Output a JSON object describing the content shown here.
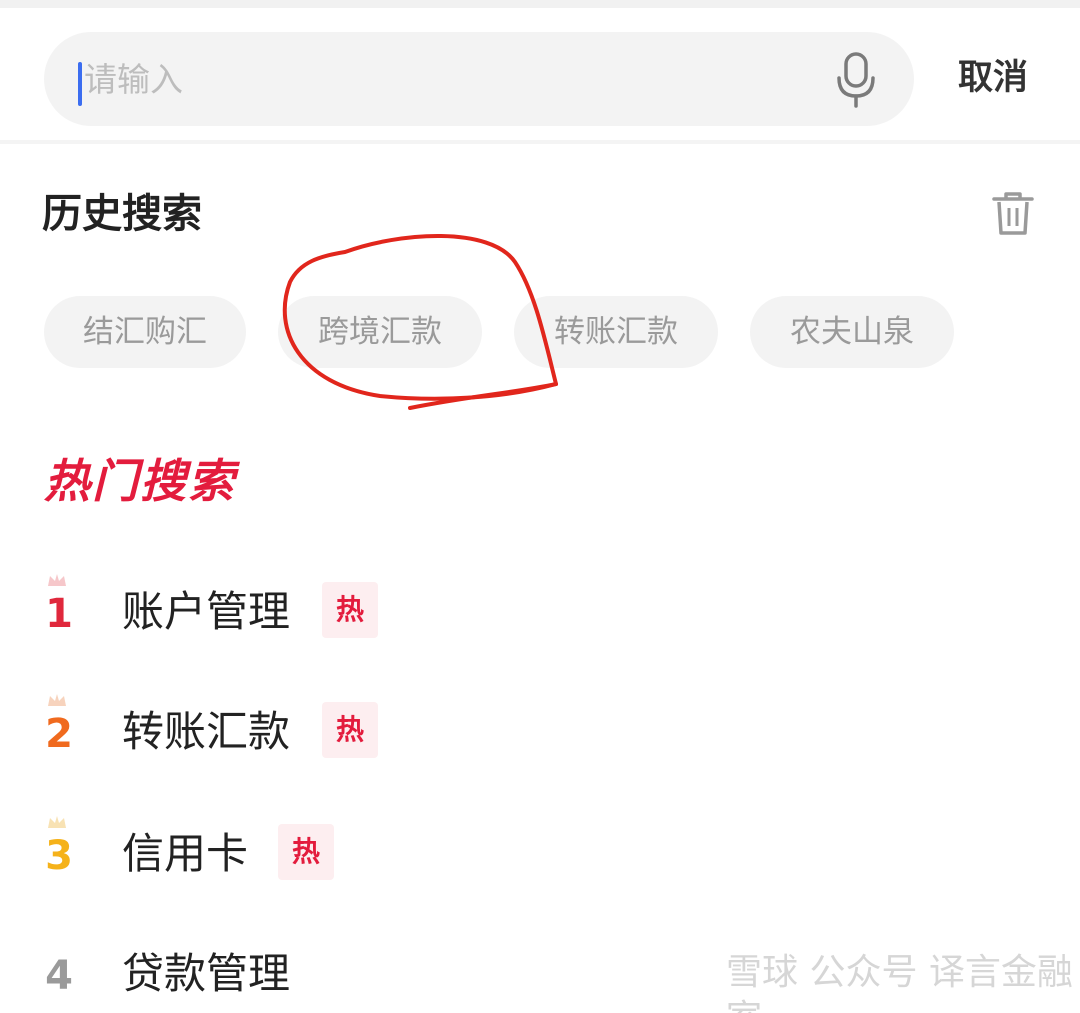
{
  "search": {
    "placeholder": "请输入",
    "value": "",
    "cancel_label": "取消",
    "mic_icon": "microphone-icon"
  },
  "history": {
    "title": "历史搜索",
    "clear_icon": "trash-icon",
    "items": [
      "结汇购汇",
      "跨境汇款",
      "转账汇款",
      "农夫山泉"
    ]
  },
  "hot": {
    "title": "热门搜索",
    "badge_label": "热",
    "items": [
      {
        "rank": "1",
        "label": "账户管理",
        "color": "#e0283c",
        "crown": true,
        "hot": true
      },
      {
        "rank": "2",
        "label": "转账汇款",
        "color": "#f06a1e",
        "crown": true,
        "hot": true
      },
      {
        "rank": "3",
        "label": "信用卡",
        "color": "#f5b21a",
        "crown": true,
        "hot": true
      },
      {
        "rank": "4",
        "label": "贷款管理",
        "color": "#9a9a9a",
        "crown": false,
        "hot": false
      }
    ]
  },
  "watermark": {
    "text": "雪球 公众号 译言金融室"
  },
  "colors": {
    "accent": "#e31c3d",
    "caret": "#3b6df0",
    "annotation": "#e1261c"
  }
}
